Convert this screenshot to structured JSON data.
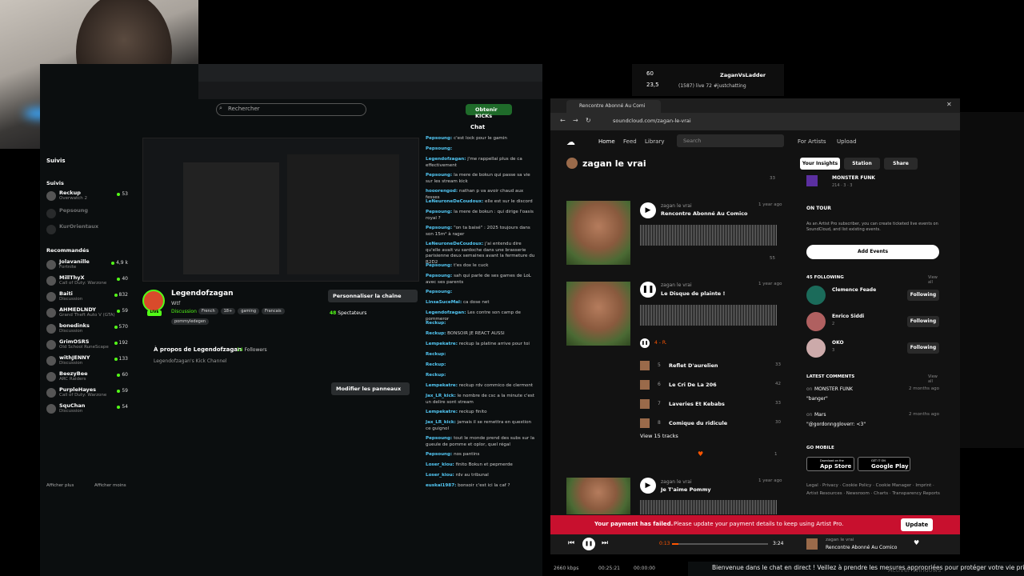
{
  "kick": {
    "search_placeholder": "Rechercher",
    "get_kicks": "Obtenir KICKs",
    "sidebar": {
      "following_header": "Suivis",
      "following_label": "Suivis",
      "following": [
        {
          "name": "Reckup",
          "game": "Overwatch 2",
          "viewers": "53"
        },
        {
          "name": "Pepsoung",
          "game": "",
          "viewers": ""
        },
        {
          "name": "KurOrientaux",
          "game": "",
          "viewers": ""
        }
      ],
      "recommended_label": "Recommandés",
      "recommended": [
        {
          "name": "Jolavanille",
          "game": "Fortnite",
          "viewers": "4,9 k"
        },
        {
          "name": "MillThyX",
          "game": "Call of Duty: Warzone",
          "viewers": "40"
        },
        {
          "name": "Baiti",
          "game": "Discussion",
          "viewers": "832"
        },
        {
          "name": "AHMEDLNDY",
          "game": "Grand Theft Auto V (GTA)",
          "viewers": "59"
        },
        {
          "name": "bonedinks",
          "game": "Discussion",
          "viewers": "570"
        },
        {
          "name": "GrimOSRS",
          "game": "Old School RuneScape",
          "viewers": "192"
        },
        {
          "name": "withJENNY",
          "game": "Discussion",
          "viewers": "133"
        },
        {
          "name": "BeezyBee",
          "game": "ARC Raiders",
          "viewers": "60"
        },
        {
          "name": "PurpleHayes",
          "game": "Call of Duty: Warzone",
          "viewers": "59"
        },
        {
          "name": "SquChan",
          "game": "Discussion",
          "viewers": "54"
        }
      ],
      "show_more": "Afficher plus",
      "show_less": "Afficher moins"
    },
    "channel": {
      "name": "Legendofzagan",
      "subtitle": "Wtf",
      "category": "Discussion",
      "tags": [
        "French",
        "18+",
        "gaming",
        "Francais"
      ],
      "tag_extra": "pommyledegen",
      "customize": "Personnaliser la chaîne",
      "viewers": "48",
      "viewers_label": "Spectateurs",
      "about_title": "À propos de Legendofzagan",
      "followers": "14",
      "followers_label": "Followers",
      "about_desc": "Legendofzagan's Kick Channel",
      "edit_panels": "Modifier les panneaux",
      "live": "LIVE"
    },
    "chat": {
      "title": "Chat",
      "messages": [
        {
          "user": "Pepsoung:",
          "text": "c'est lock pour le gamin"
        },
        {
          "user": "Pepsoung:",
          "text": ""
        },
        {
          "user": "Legendofzagan:",
          "text": "j'me rappellai plus de ca effectivement"
        },
        {
          "user": "Pepsoung:",
          "text": "la mere de bokun qui passe sa vie sur les stream kick"
        },
        {
          "user": "hooorengod:",
          "text": "nathan p va avoir chaud aux fesses"
        },
        {
          "user": "LeNeuroneDeCoudoux:",
          "text": "elle est sur le discord"
        },
        {
          "user": "Pepsoung:",
          "text": "la mere de bokun : qui dirige l'oasis royal ?"
        },
        {
          "user": "Pepsoung:",
          "text": "\"on ta baisé\" : 2025 toujours dans son 15m² à rager"
        },
        {
          "user": "LeNeuroneDeCoudoux:",
          "text": "j'ai entendu dire qu'elle avait vu sardoche dans une brasserie parisienne deux semaines avant la fermeture du R2D2"
        },
        {
          "user": "Pepsoung:",
          "text": "t'es dox le cuck"
        },
        {
          "user": "Pepsoung:",
          "text": "sah qui parle de ses games de LoL avec ses parents"
        },
        {
          "user": "Pepsoung:",
          "text": ""
        },
        {
          "user": "LinsaSuceMal:",
          "text": "ca dose net"
        },
        {
          "user": "Legendofzagan:",
          "text": "Les contre son camp de pommeror"
        },
        {
          "user": "Reckup:",
          "text": ""
        },
        {
          "user": "Reckup:",
          "text": "BONSOIR JE REACT AUSSI"
        },
        {
          "user": "Lempekatre:",
          "text": "reckup la platine arrive pour toi"
        },
        {
          "user": "Reckup:",
          "text": ""
        },
        {
          "user": "Reckup:",
          "text": ""
        },
        {
          "user": "Reckup:",
          "text": ""
        },
        {
          "user": "Lempekatre:",
          "text": "reckup rdv commico de clermont"
        },
        {
          "user": "Jax_LR_kick:",
          "text": "le nombre de csc a la minute c'est un delire sont stream"
        },
        {
          "user": "Lempekatre:",
          "text": "reckup finito"
        },
        {
          "user": "Jax_LR_kick:",
          "text": "jamais il se remettra en question ce guignol"
        },
        {
          "user": "Pepsoung:",
          "text": "tout le monde prend des subs sur la gueule de pomme et oplor, quel régal"
        },
        {
          "user": "Pepsoung:",
          "text": "nos pantins"
        },
        {
          "user": "Loser_kiou:",
          "text": "finito Bokun et pepmerde"
        },
        {
          "user": "Loser_kiou:",
          "text": "rdv au tribunal"
        },
        {
          "user": "euskal1987:",
          "text": "bonsoir c'est ici la caf ?"
        }
      ]
    }
  },
  "soundcloud": {
    "tab_title": "Rencontre Abonné Au Comi",
    "url": "soundcloud.com/zagan-le-vrai",
    "nav": {
      "home": "Home",
      "feed": "Feed",
      "library": "Library",
      "search_placeholder": "Search",
      "for_artists": "For Artists",
      "upload": "Upload"
    },
    "profile_name": "zagan le vrai",
    "buttons": {
      "insights": "Your Insights",
      "station": "Station",
      "share": "Share"
    },
    "tracks": [
      {
        "artist": "zagan le vrai",
        "title": "Rencontre Abonné Au Comico",
        "age": "1 year ago",
        "count": "55"
      },
      {
        "artist": "zagan le vrai",
        "title": "Le Disque de plainte !",
        "age": "1 year ago",
        "count": ""
      },
      {
        "artist": "zagan le vrai",
        "title": "Je T'aime Pommy",
        "age": "1 year ago",
        "count": ""
      }
    ],
    "first_counts": {
      "top": "33"
    },
    "playlist_current": {
      "num": "4",
      "title": "R."
    },
    "playlist": [
      {
        "num": "5",
        "title": "Reflet D'aurelien",
        "plays": "33"
      },
      {
        "num": "6",
        "title": "Le Cri De La 206",
        "plays": "42"
      },
      {
        "num": "7",
        "title": "Laveries Et Kebabs",
        "plays": "33"
      },
      {
        "num": "8",
        "title": "Comique du ridicule",
        "plays": "30"
      }
    ],
    "view_tracks": "View 15 tracks",
    "like_count": "1",
    "sidebar": {
      "monster_funk": "MONSTER FUNK",
      "mf_stats": "214 · 3 · 3",
      "on_tour": "ON TOUR",
      "tour_desc": "As an Artist Pro subscriber, you can create ticketed live events on SoundCloud, and list existing events.",
      "add_events": "Add Events",
      "following_count": "45 FOLLOWING",
      "view_all": "View all",
      "following": [
        {
          "name": "Clemence Feade",
          "count": "",
          "btn": "Following"
        },
        {
          "name": "Enrico Siddi",
          "count": "2",
          "btn": "Following"
        },
        {
          "name": "OKO",
          "count": "3",
          "btn": "Following"
        }
      ],
      "latest_comments": "LATEST COMMENTS",
      "comments": [
        {
          "on": "on",
          "track": "MONSTER FUNK",
          "when": "2 months ago",
          "text": "\"banger\""
        },
        {
          "on": "on",
          "track": "Mars",
          "when": "2 months ago",
          "text": "\"@gordonnggloverr: <3\""
        }
      ],
      "go_mobile": "GO MOBILE",
      "app_store": "App Store",
      "app_store_small": "Download on the",
      "google_play": "Google Play",
      "google_play_small": "GET IT ON",
      "footer_links": "Legal · Privacy · Cookie Policy · Cookie Manager · Imprint · Artist Resources · Newsroom · Charts · Transparency Reports"
    },
    "banner": {
      "bold": "Your payment has failed.",
      "text": "Please update your payment details to keep using Artist Pro.",
      "btn": "Update"
    },
    "player": {
      "elapsed": "0:13",
      "duration": "3:24",
      "artist": "zagan le vrai",
      "title": "Rencontre Abonné Au Comico"
    }
  },
  "other": {
    "mini_tab": "(1587) live 72 #justchatting",
    "mini_stats": [
      "60",
      "23,5"
    ],
    "zagan_ladder": "ZaganVsLadder",
    "status": [
      "2660 kbps",
      "00:25:21",
      "00:00:00"
    ],
    "notice": "Bienvenue dans le chat en direct ! Veillez à prendre les mesures appropriées pour protéger votre vie privée et à respecter le",
    "notice2": "Activer Windows"
  },
  "colors": {
    "kick_green": "#53fc18",
    "sc_banner": "#c8102e",
    "chat_user": "#53c8f5"
  }
}
